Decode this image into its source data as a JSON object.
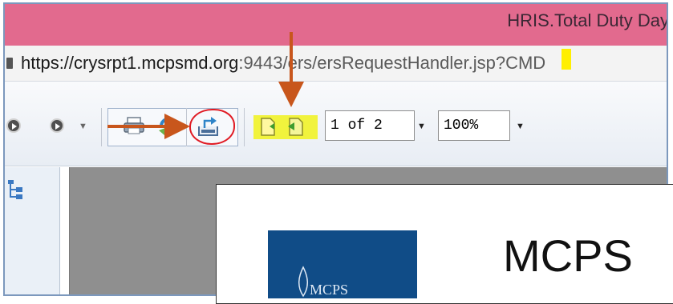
{
  "window": {
    "title": "HRIS.Total Duty Days"
  },
  "address_bar": {
    "url_host": "https://crysrpt1.mcpsmd.org",
    "url_rest": ":9443/ers/ersRequestHandler.jsp?CMD"
  },
  "toolbar": {
    "page_value": "1 of 2",
    "zoom_value": "100%",
    "dropdown_glyph": "▼"
  },
  "document": {
    "heading": "MCPS",
    "logo_text": "MCPS"
  },
  "colors": {
    "title_bar": "#e26a8e",
    "annotation_arrow": "#c8561c",
    "annotation_circle": "#e01b24",
    "highlight": "#f1f33d",
    "logo_bg": "#104c87"
  },
  "icons": [
    "lock-icon",
    "back-icon",
    "forward-icon",
    "print-icon",
    "refresh-icon",
    "export-icon",
    "prev-page-icon",
    "next-page-icon",
    "group-tree-icon"
  ]
}
